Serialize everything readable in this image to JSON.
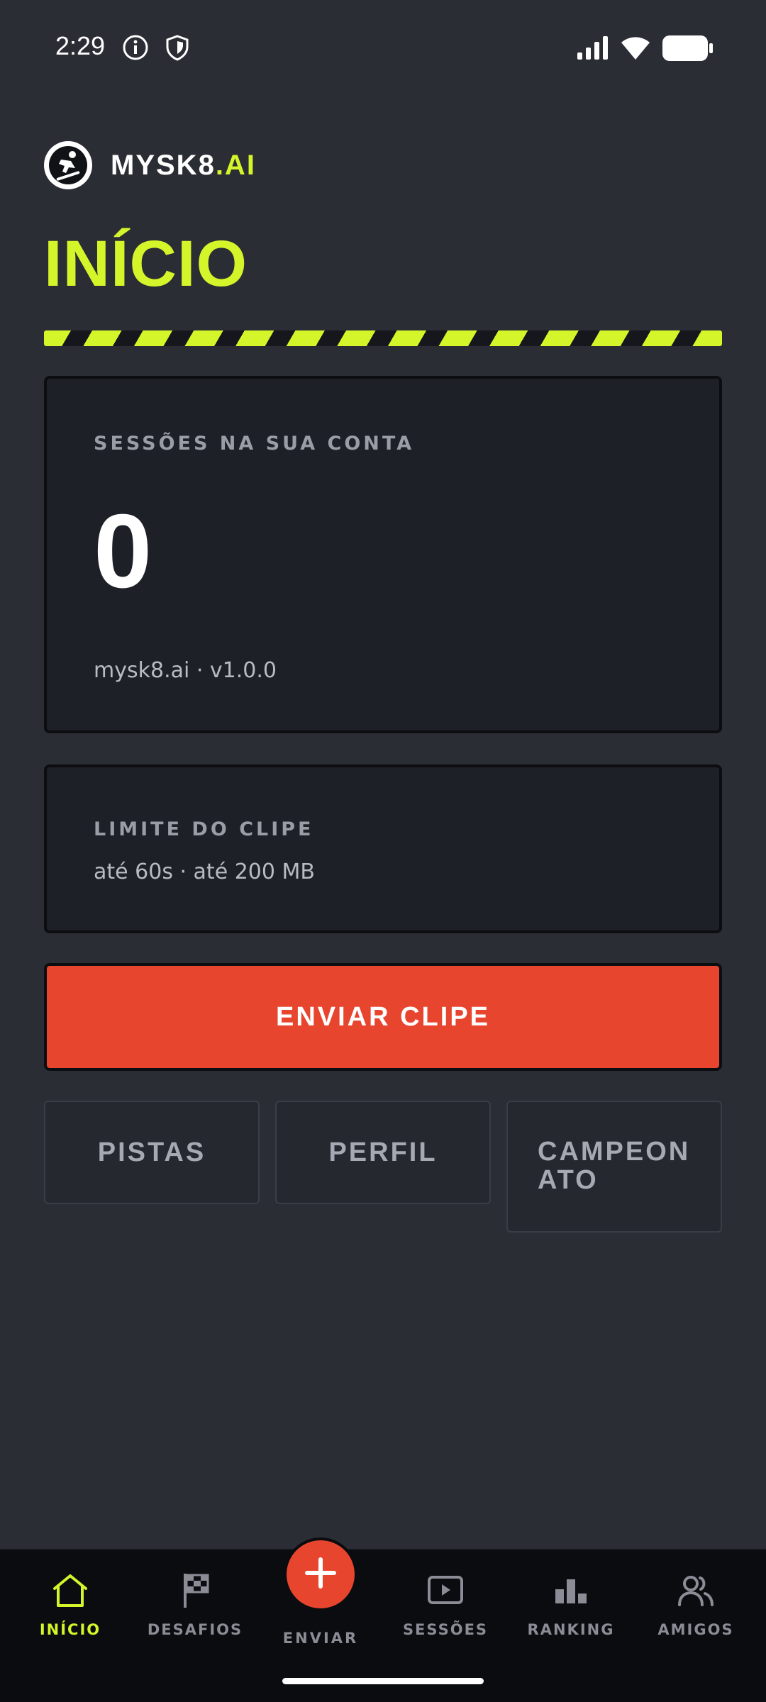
{
  "status_bar": {
    "time": "2:29",
    "icons": [
      "info-icon",
      "shield-icon",
      "signal-icon",
      "wifi-icon",
      "battery-icon"
    ]
  },
  "brand": {
    "name_main": "MYSK8",
    "name_accent": ".AI",
    "logo_icon": "skater-logo-icon"
  },
  "page": {
    "title": "INÍCIO"
  },
  "sessions_card": {
    "label": "SESSÕES NA SUA CONTA",
    "count": "0",
    "footer": "mysk8.ai · v1.0.0"
  },
  "clip_limit_card": {
    "label": "LIMITE DO CLIPE",
    "value": "até 60s · até 200 MB"
  },
  "upload_button": {
    "label": "ENVIAR CLIPE"
  },
  "quick_actions": [
    {
      "label": "PISTAS"
    },
    {
      "label": "PERFIL"
    },
    {
      "label_line1": "CAMPEON",
      "label_line2": "ATO"
    }
  ],
  "bottom_nav": {
    "items": [
      {
        "label": "INÍCIO",
        "icon": "home-icon",
        "active": true
      },
      {
        "label": "DESAFIOS",
        "icon": "flag-icon",
        "active": false
      },
      {
        "label": "ENVIAR",
        "icon": "plus-icon",
        "active": false
      },
      {
        "label": "SESSÕES",
        "icon": "play-icon",
        "active": false
      },
      {
        "label": "RANKING",
        "icon": "bar-chart-icon",
        "active": false
      },
      {
        "label": "AMIGOS",
        "icon": "users-icon",
        "active": false
      }
    ]
  },
  "colors": {
    "accent": "#d4f52a",
    "danger": "#e8452e",
    "background": "#2b2d35",
    "card": "#1e2027"
  }
}
